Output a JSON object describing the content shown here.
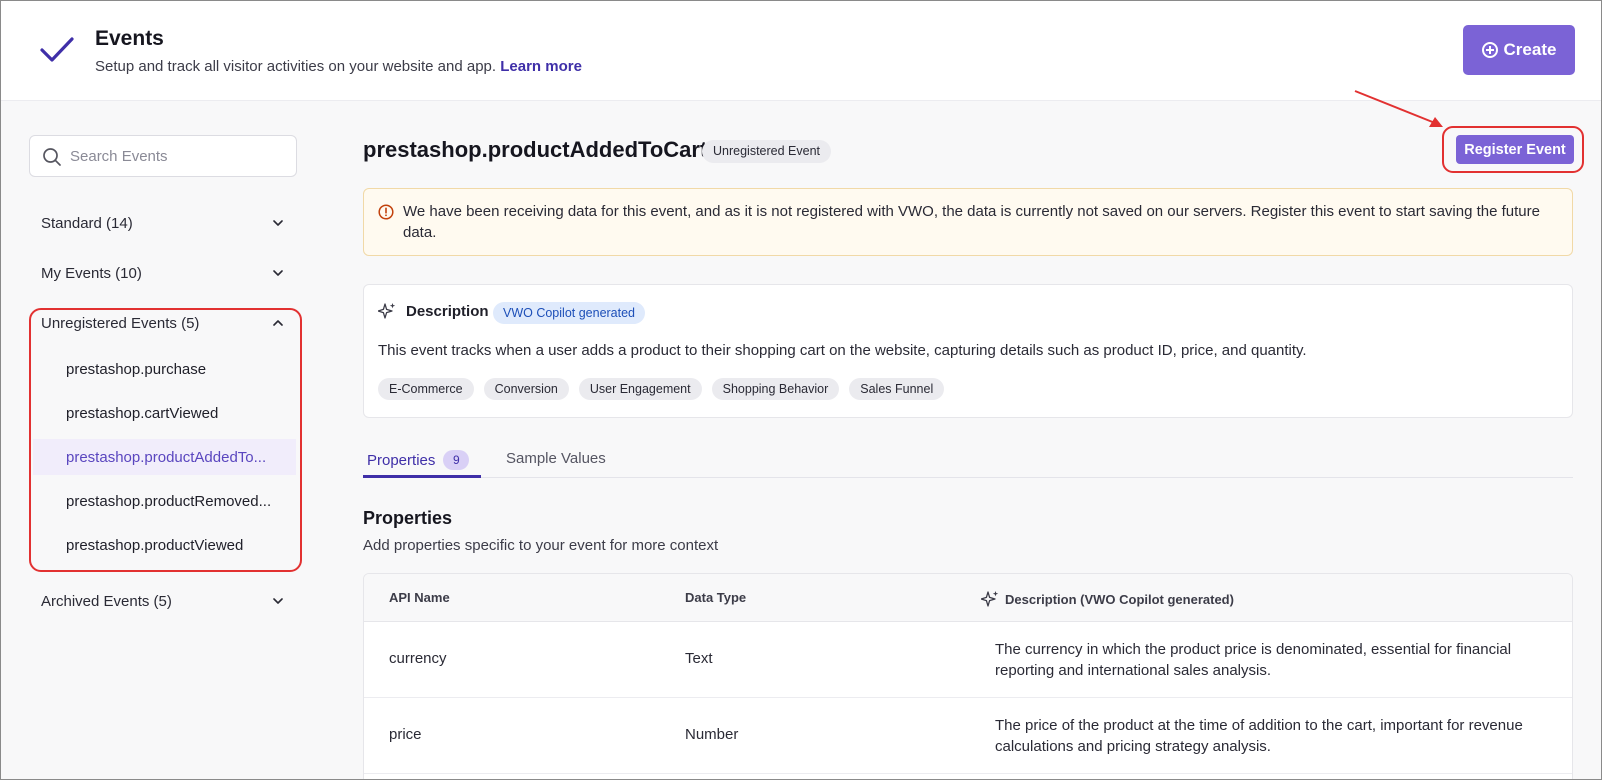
{
  "header": {
    "title": "Events",
    "subtitle": "Setup and track all visitor activities on your website and app.",
    "learn_more": "Learn more",
    "create_label": "Create"
  },
  "sidebar": {
    "search_placeholder": "Search Events",
    "groups": {
      "standard": "Standard (14)",
      "my_events": "My Events (10)",
      "unregistered": "Unregistered Events (5)",
      "archived": "Archived Events (5)"
    },
    "unregistered_items": [
      "prestashop.purchase",
      "prestashop.cartViewed",
      "prestashop.productAddedTo...",
      "prestashop.productRemoved...",
      "prestashop.productViewed"
    ]
  },
  "main": {
    "event_name": "prestashop.productAddedToCart",
    "status_badge": "Unregistered Event",
    "register_label": "Register Event",
    "warning_text": "We have been receiving data for this event, and as it is not registered with VWO, the data is currently not saved on our servers. Register this event to start saving the future data.",
    "description": {
      "title": "Description",
      "badge": "VWO Copilot generated",
      "text": "This event tracks when a user adds a product to their shopping cart on the website, capturing details such as product ID, price, and quantity.",
      "tags": [
        "E-Commerce",
        "Conversion",
        "User Engagement",
        "Shopping Behavior",
        "Sales Funnel"
      ]
    },
    "tabs": {
      "properties": "Properties",
      "properties_count": "9",
      "sample_values": "Sample Values"
    },
    "properties": {
      "heading": "Properties",
      "subheading": "Add properties specific to your event for more context",
      "columns": {
        "api_name": "API Name",
        "data_type": "Data Type",
        "description": "Description (VWO Copilot generated)"
      },
      "rows": [
        {
          "api_name": "currency",
          "data_type": "Text",
          "description": "The currency in which the product price is denominated, essential for financial reporting and international sales analysis."
        },
        {
          "api_name": "price",
          "data_type": "Number",
          "description": "The price of the product at the time of addition to the cart, important for revenue calculations and pricing strategy analysis."
        }
      ]
    }
  },
  "colors": {
    "accent": "#7b63d6",
    "link": "#3f2fa8",
    "annotation": "#e23131"
  }
}
